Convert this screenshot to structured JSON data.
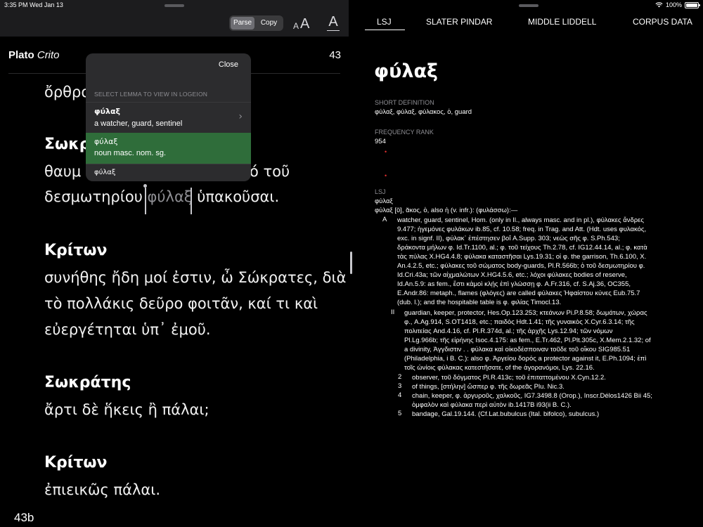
{
  "status": {
    "time_date": "3:35 PM  Wed Jan 13",
    "battery": "100%"
  },
  "toolbar": {
    "parse_label": "Parse",
    "copy_label": "Copy",
    "aa_small": "A",
    "aa_big": "A",
    "a_underline": "A"
  },
  "reader": {
    "work_author": "Plato",
    "work_title": "Crito",
    "page": "43",
    "bottom_page": "43b",
    "lines": {
      "l1": "ὄρθρο",
      "s1": "Σωκρ",
      "l2a": "θαυμ",
      "l2b": "ό τοῦ",
      "l3a": "δεσμωτηρίου ",
      "l3_word": "φύλαξ",
      "l3b": " ὑπακοῦσαι.",
      "s2": "Κρίτων",
      "l4": "συνήθης ἤδη μοί ἐστιν, ὦ Σώκρατες, διὰ",
      "l5": "τὸ πολλάκις δεῦρο φοιτᾶν, καί τι καὶ",
      "l6": "εὐεργέτηται ὑπ᾽ ἐμοῦ.",
      "s3": "Σωκράτης",
      "l7": "ἄρτι δὲ ἥκεις ἢ πάλαι;",
      "s4": "Κρίτων",
      "l8": "ἐπιεικῶς πάλαι."
    }
  },
  "popover": {
    "close_label": "Close",
    "header": "SELECT LEMMA TO VIEW IN LOGEION",
    "rows": [
      {
        "lemma": "φύλαξ",
        "gloss": "a watcher, guard, sentinel"
      },
      {
        "lemma": "φύλαξ",
        "gloss": "noun masc. nom. sg."
      },
      {
        "lemma": "φύλαξ",
        "gloss": ""
      }
    ]
  },
  "tabs": [
    "LSJ",
    "SLATER PINDAR",
    "MIDDLE LIDDELL",
    "CORPUS DATA"
  ],
  "entry": {
    "lemma": "φύλαξ",
    "short_def_label": "SHORT DEFINITION",
    "short_def": "φύλαξ, φύλαξ, φύλακος, ὁ, guard",
    "freq_label": "FREQUENCY RANK",
    "freq": "954",
    "lsj_label": "LSJ",
    "lsj_head1": "φύλαξ",
    "lsj_head2": "φύλαξ [ῠ], ᾰκος, ὁ, also ἡ (v. infr.): (φυλάσσω):—",
    "lines": [
      "watcher, guard, sentinel, Hom. (only in Il., always masc. and in pl.), φύλακες ἄνδρες",
      "9.477; ἡγεμόνες φυλάκων ib.85, cf. 10.58; freq. in Trag. and Att. (Hdt. uses φυλακός,",
      "exc. in signf. II), φύλακ᾽ ἐπέστησεν βοΐ A.Supp. 303; νεὼς σῆς φ. S.Ph.543;",
      "δράκοντα μήλων φ. Id.Tr.1100, al.; φ. τοῦ τείχους Th.2.78, cf. IG12.44.14, al.; φ. κατὰ",
      "τὰς πύλας X.HG4.4.8; φύλακα καταστῆσαι Lys.19.31; οἱ φ. the garrison, Th.6.100, X.",
      "An.4.2.5, etc.; φύλακες τοῦ σώματος body-guards, Pl.R.566b; ὁ τοῦ δεσμωτηρίου φ.",
      "Id.Cri.43a; τῶν αἰχμαλώτων X.HG4.5.6, etc.; λόχοι φύλακες bodies of reserve,",
      "Id.An.5.9: as fem., ἔστι κἀμοὶ κλῄς ἐπὶ γλώσσῃ φ. A.Fr.316, cf. S.Aj.36, OC355,",
      "E.Andr.86: metaph., flames (φλόγες) are called φύλακες Ἡφαίστου κύνες Eub.75.7",
      "(dub. l.); and the hospitable table is φ. φιλίας Timocl.13."
    ],
    "lines2": [
      "guardian, keeper, protector, Hes.Op.123.253; κτεάνων Pi.P.8.58; δωμάτων, χώρας",
      "φ., A.Ag.914, S.OT1418, etc.; παιδὸς Hdt.1.41; τῆς γυναικὸς X.Cyr.6.3.14; τῆς",
      "πολιτείας And.4.16, cf. Pl.R.374d, al.; τῆς ἀρχῆς Lys.12.94; τῶν νόμων",
      "Pl.Lg.966b; τῆς εἰρήνης Isoc.4.175: as fem., E.Tr.462, Pl.Plt.305c, X.Mem.2.1.32; of",
      "a divinity, Ἀγγδιστιν . . φύλακα καὶ οἰκοδέσποιναν τοῦδε τοῦ οἴκου SIG985.51",
      "(Philadelphia, i B. C.): also φ. Ἀργείου δορός a protector against it, E.Ph.1094; ἐπὶ",
      "τοῖς ὠνίοις φύλακας κατεστῆσατε, of the ἀγορανόμοι, Lys. 22.16."
    ],
    "sub": [
      {
        "num": "2",
        "text": "observer, τοῦ δόγματος Pl.R.413c; τοῦ ἐπιταττομένου X.Cyn.12.2."
      },
      {
        "num": "3",
        "text": "of things, [στήλην] ὥσπερ φ. τῆς δωρεᾶς Plu. Nic.3."
      },
      {
        "num": "4",
        "text": "chain, keeper, φ. ἀργυροῦς, χαλκοῦς, IG7.3498.8 (Orop.), Inscr.Délos1426 Bii 45;"
      },
      {
        "num": "",
        "text": "ὀμφαλὸν καὶ φύλακα περὶ αὐτὸν ib.1417B i93(ii B. C.)."
      },
      {
        "num": "5",
        "text": "bandage, Gal.19.144. (Cf.Lat.bubulcus (Ital. bifolco), subulcus.)"
      }
    ],
    "markers": {
      "a": "A",
      "b": "II"
    }
  }
}
